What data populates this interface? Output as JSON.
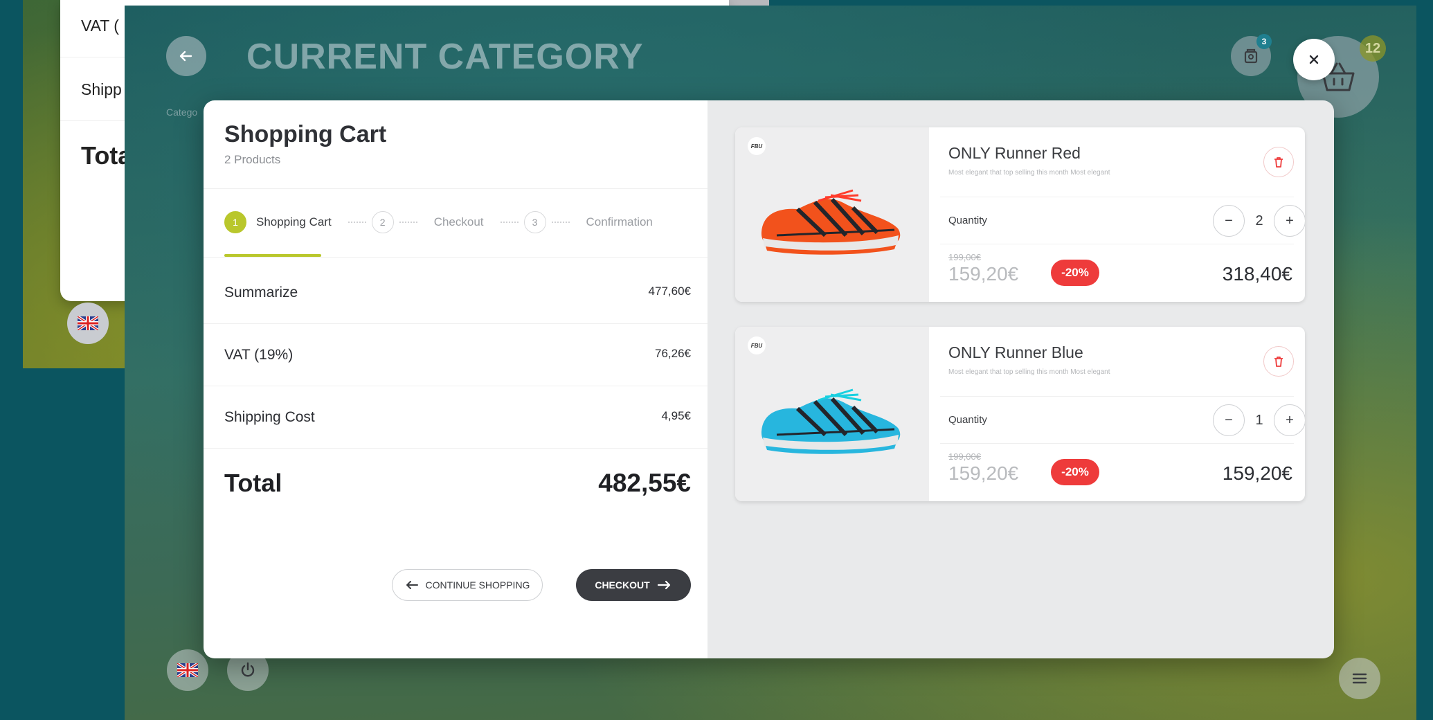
{
  "background_panel": {
    "rows": [
      {
        "label": "VAT ("
      },
      {
        "label": "Shipp"
      },
      {
        "label": "Tota"
      }
    ]
  },
  "header": {
    "title": "CURRENT CATEGORY",
    "breadcrumb": "Catego",
    "orders_badge": "3",
    "basket_badge": "12"
  },
  "cart": {
    "title": "Shopping Cart",
    "count_text": "2 Products",
    "steps": [
      {
        "number": "1",
        "label": "Shopping Cart",
        "active": true
      },
      {
        "number": "2",
        "label": "Checkout",
        "active": false
      },
      {
        "number": "3",
        "label": "Confirmation",
        "active": false
      }
    ],
    "summary": [
      {
        "label": "Summarize",
        "value": "477,60€"
      },
      {
        "label": "VAT (19%)",
        "value": "76,26€"
      },
      {
        "label": "Shipping Cost",
        "value": "4,95€"
      }
    ],
    "total": {
      "label": "Total",
      "value": "482,55€"
    },
    "continue_label": "CONTINUE SHOPPING",
    "checkout_label": "CHECKOUT"
  },
  "products": [
    {
      "brand": "FBU",
      "name": "ONLY Runner Red",
      "description": "Most elegant that top selling this month Most elegant",
      "quantity_label": "Quantity",
      "quantity": "2",
      "old_price": "199,00€",
      "price": "159,20€",
      "discount": "-20%",
      "line_total": "318,40€",
      "colors": {
        "primary": "#f2521c",
        "secondary": "#23252b",
        "sole": "#e8e8e8"
      }
    },
    {
      "brand": "FBU",
      "name": "ONLY Runner Blue",
      "description": "Most elegant that top selling this month Most elegant",
      "quantity_label": "Quantity",
      "quantity": "1",
      "old_price": "199,00€",
      "price": "159,20€",
      "discount": "-20%",
      "line_total": "159,20€",
      "colors": {
        "primary": "#27b6de",
        "secondary": "#23252b",
        "sole": "#e8e8e8"
      }
    }
  ],
  "theme": {
    "accent": "#b9c72c",
    "danger": "#ee3b3b",
    "dark_button": "#3b3d42"
  },
  "icons": {
    "back": "arrow-left-icon",
    "orders": "receipt-icon",
    "basket": "basket-icon",
    "close": "close-icon",
    "flag": "uk-flag-icon",
    "power": "power-icon",
    "menu": "menu-icon",
    "trash": "trash-icon"
  }
}
